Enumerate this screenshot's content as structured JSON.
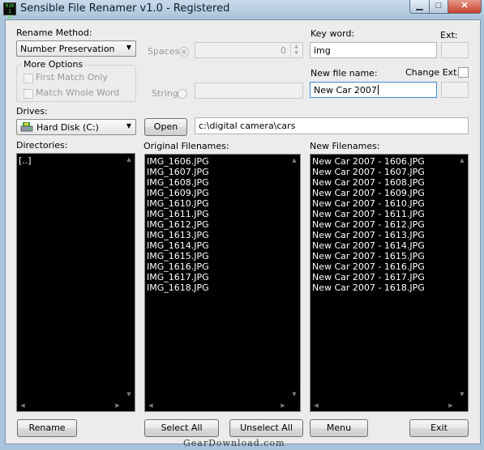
{
  "window": {
    "title": "Sensible File Renamer v1.0 - Registered",
    "app_icon_text": "010 1 10"
  },
  "rename_method": {
    "label": "Rename Method:",
    "selected": "Number Preservation"
  },
  "more_options": {
    "title": "More Options",
    "first_match_only": "First Match Only",
    "match_whole_word": "Match Whole Word"
  },
  "spaces": {
    "label": "Spaces",
    "value": "0"
  },
  "string_option": {
    "label": "String",
    "value": ""
  },
  "key_word": {
    "label": "Key word:",
    "value": "img"
  },
  "ext": {
    "label": "Ext:",
    "value": ""
  },
  "new_file_name": {
    "label": "New file name:",
    "value": "New Car 2007"
  },
  "change_ext": {
    "label": "Change Ext."
  },
  "drives": {
    "label": "Drives:",
    "selected": "Hard Disk (C:)"
  },
  "open_button": "Open",
  "path": {
    "value": "c:\\digital camera\\cars"
  },
  "directories": {
    "label": "Directories:",
    "items": [
      "[..]"
    ]
  },
  "original_filenames": {
    "label": "Original Filenames:",
    "items": [
      "IMG_1606.JPG",
      "IMG_1607.JPG",
      "IMG_1608.JPG",
      "IMG_1609.JPG",
      "IMG_1610.JPG",
      "IMG_1611.JPG",
      "IMG_1612.JPG",
      "IMG_1613.JPG",
      "IMG_1614.JPG",
      "IMG_1615.JPG",
      "IMG_1616.JPG",
      "IMG_1617.JPG",
      "IMG_1618.JPG"
    ]
  },
  "new_filenames": {
    "label": "New Filenames:",
    "items": [
      "New Car 2007 - 1606.JPG",
      "New Car 2007 - 1607.JPG",
      "New Car 2007 - 1608.JPG",
      "New Car 2007 - 1609.JPG",
      "New Car 2007 - 1610.JPG",
      "New Car 2007 - 1611.JPG",
      "New Car 2007 - 1612.JPG",
      "New Car 2007 - 1613.JPG",
      "New Car 2007 - 1614.JPG",
      "New Car 2007 - 1615.JPG",
      "New Car 2007 - 1616.JPG",
      "New Car 2007 - 1617.JPG",
      "New Car 2007 - 1618.JPG"
    ]
  },
  "buttons": {
    "rename": "Rename",
    "select_all": "Select All",
    "unselect_all": "Unselect All",
    "menu": "Menu",
    "exit": "Exit"
  },
  "watermark": "GearDownload.com",
  "colors": {
    "list_background": "#000000",
    "list_text": "#ffffff",
    "window_frame": "#a9c3dc",
    "close_button": "#c5412c"
  },
  "icons": [
    "app-icon",
    "minimize-icon",
    "maximize-icon",
    "close-icon",
    "chevron-down-icon",
    "hard-disk-icon",
    "scroll-up-icon",
    "scroll-down-icon",
    "scroll-left-icon",
    "scroll-right-icon"
  ]
}
